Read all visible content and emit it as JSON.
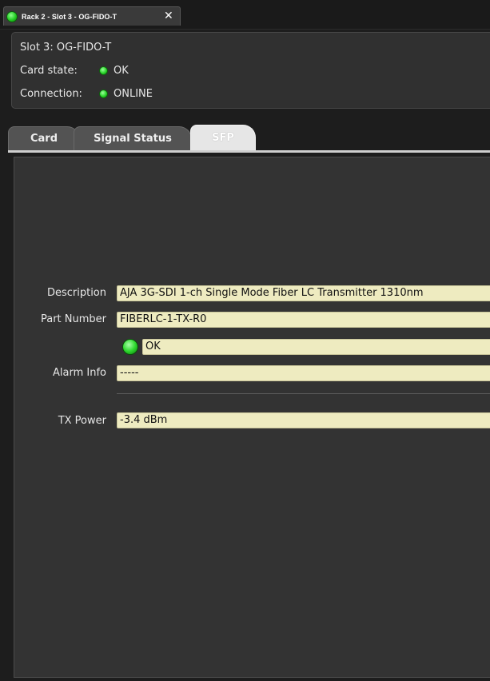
{
  "window_tab": {
    "title": "Rack 2 - Slot 3 - OG-FIDO-T",
    "close_glyph": "✕"
  },
  "header": {
    "slot": "Slot 3: OG-FIDO-T",
    "card_state_label": "Card state:",
    "card_state_value": "OK",
    "connection_label": "Connection:",
    "connection_value": "ONLINE"
  },
  "tabs": [
    {
      "label": "Card",
      "active": false
    },
    {
      "label": "Signal Status",
      "active": false
    },
    {
      "label": "SFP",
      "active": true
    }
  ],
  "sfp": {
    "description_label": "Description",
    "description_value": "AJA 3G-SDI 1-ch Single Mode Fiber LC Transmitter 1310nm",
    "part_number_label": "Part Number",
    "part_number_value": "FIBERLC-1-TX-R0",
    "status_value": "OK",
    "alarm_label": "Alarm Info",
    "alarm_value": "-----",
    "tx_power_label": "TX Power",
    "tx_power_value": "-3.4 dBm"
  },
  "colors": {
    "led_green": "#2ad62a",
    "field_bg": "#eeebc0",
    "panel_bg": "#333333"
  }
}
